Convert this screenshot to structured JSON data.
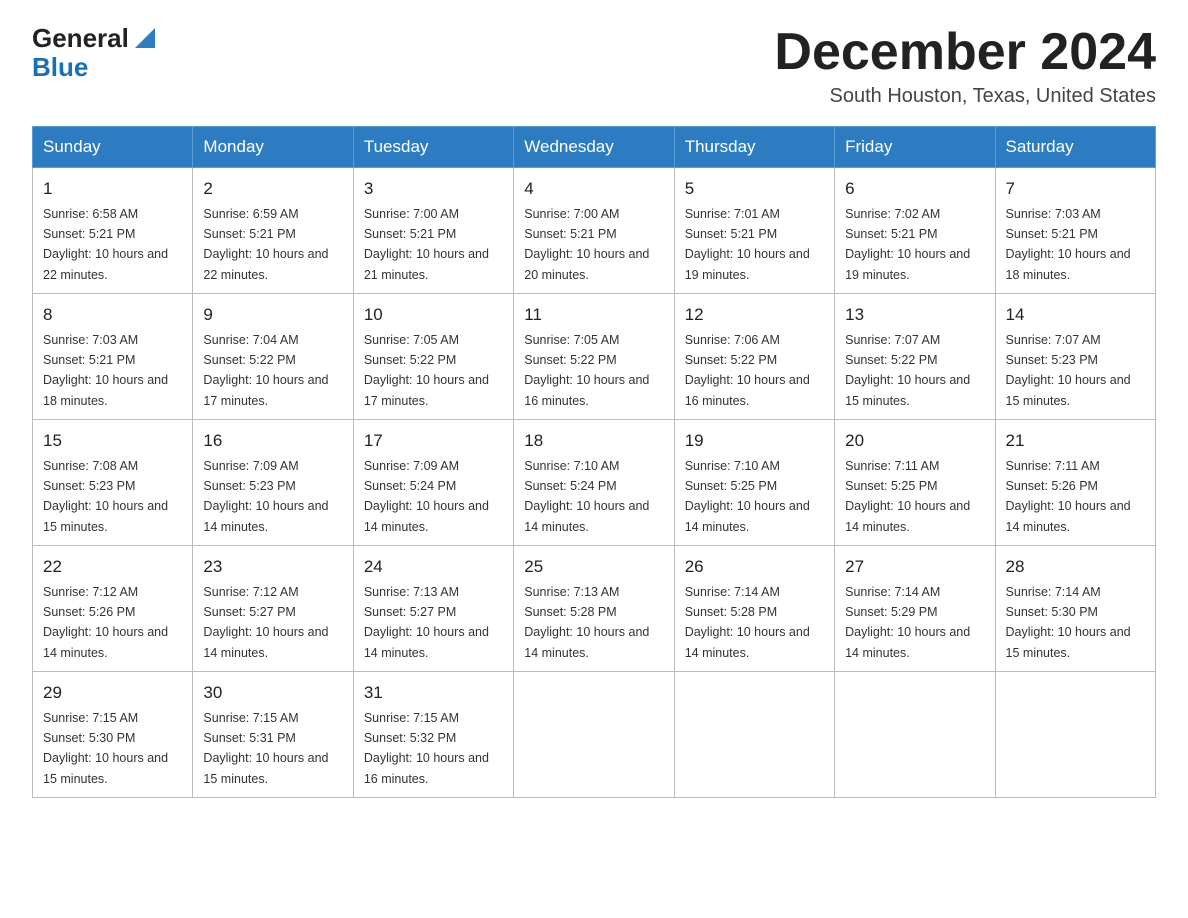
{
  "header": {
    "logo_general": "General",
    "logo_blue": "Blue",
    "month_title": "December 2024",
    "location": "South Houston, Texas, United States"
  },
  "days_of_week": [
    "Sunday",
    "Monday",
    "Tuesday",
    "Wednesday",
    "Thursday",
    "Friday",
    "Saturday"
  ],
  "weeks": [
    [
      {
        "num": "1",
        "sunrise": "6:58 AM",
        "sunset": "5:21 PM",
        "daylight": "10 hours and 22 minutes."
      },
      {
        "num": "2",
        "sunrise": "6:59 AM",
        "sunset": "5:21 PM",
        "daylight": "10 hours and 22 minutes."
      },
      {
        "num": "3",
        "sunrise": "7:00 AM",
        "sunset": "5:21 PM",
        "daylight": "10 hours and 21 minutes."
      },
      {
        "num": "4",
        "sunrise": "7:00 AM",
        "sunset": "5:21 PM",
        "daylight": "10 hours and 20 minutes."
      },
      {
        "num": "5",
        "sunrise": "7:01 AM",
        "sunset": "5:21 PM",
        "daylight": "10 hours and 19 minutes."
      },
      {
        "num": "6",
        "sunrise": "7:02 AM",
        "sunset": "5:21 PM",
        "daylight": "10 hours and 19 minutes."
      },
      {
        "num": "7",
        "sunrise": "7:03 AM",
        "sunset": "5:21 PM",
        "daylight": "10 hours and 18 minutes."
      }
    ],
    [
      {
        "num": "8",
        "sunrise": "7:03 AM",
        "sunset": "5:21 PM",
        "daylight": "10 hours and 18 minutes."
      },
      {
        "num": "9",
        "sunrise": "7:04 AM",
        "sunset": "5:22 PM",
        "daylight": "10 hours and 17 minutes."
      },
      {
        "num": "10",
        "sunrise": "7:05 AM",
        "sunset": "5:22 PM",
        "daylight": "10 hours and 17 minutes."
      },
      {
        "num": "11",
        "sunrise": "7:05 AM",
        "sunset": "5:22 PM",
        "daylight": "10 hours and 16 minutes."
      },
      {
        "num": "12",
        "sunrise": "7:06 AM",
        "sunset": "5:22 PM",
        "daylight": "10 hours and 16 minutes."
      },
      {
        "num": "13",
        "sunrise": "7:07 AM",
        "sunset": "5:22 PM",
        "daylight": "10 hours and 15 minutes."
      },
      {
        "num": "14",
        "sunrise": "7:07 AM",
        "sunset": "5:23 PM",
        "daylight": "10 hours and 15 minutes."
      }
    ],
    [
      {
        "num": "15",
        "sunrise": "7:08 AM",
        "sunset": "5:23 PM",
        "daylight": "10 hours and 15 minutes."
      },
      {
        "num": "16",
        "sunrise": "7:09 AM",
        "sunset": "5:23 PM",
        "daylight": "10 hours and 14 minutes."
      },
      {
        "num": "17",
        "sunrise": "7:09 AM",
        "sunset": "5:24 PM",
        "daylight": "10 hours and 14 minutes."
      },
      {
        "num": "18",
        "sunrise": "7:10 AM",
        "sunset": "5:24 PM",
        "daylight": "10 hours and 14 minutes."
      },
      {
        "num": "19",
        "sunrise": "7:10 AM",
        "sunset": "5:25 PM",
        "daylight": "10 hours and 14 minutes."
      },
      {
        "num": "20",
        "sunrise": "7:11 AM",
        "sunset": "5:25 PM",
        "daylight": "10 hours and 14 minutes."
      },
      {
        "num": "21",
        "sunrise": "7:11 AM",
        "sunset": "5:26 PM",
        "daylight": "10 hours and 14 minutes."
      }
    ],
    [
      {
        "num": "22",
        "sunrise": "7:12 AM",
        "sunset": "5:26 PM",
        "daylight": "10 hours and 14 minutes."
      },
      {
        "num": "23",
        "sunrise": "7:12 AM",
        "sunset": "5:27 PM",
        "daylight": "10 hours and 14 minutes."
      },
      {
        "num": "24",
        "sunrise": "7:13 AM",
        "sunset": "5:27 PM",
        "daylight": "10 hours and 14 minutes."
      },
      {
        "num": "25",
        "sunrise": "7:13 AM",
        "sunset": "5:28 PM",
        "daylight": "10 hours and 14 minutes."
      },
      {
        "num": "26",
        "sunrise": "7:14 AM",
        "sunset": "5:28 PM",
        "daylight": "10 hours and 14 minutes."
      },
      {
        "num": "27",
        "sunrise": "7:14 AM",
        "sunset": "5:29 PM",
        "daylight": "10 hours and 14 minutes."
      },
      {
        "num": "28",
        "sunrise": "7:14 AM",
        "sunset": "5:30 PM",
        "daylight": "10 hours and 15 minutes."
      }
    ],
    [
      {
        "num": "29",
        "sunrise": "7:15 AM",
        "sunset": "5:30 PM",
        "daylight": "10 hours and 15 minutes."
      },
      {
        "num": "30",
        "sunrise": "7:15 AM",
        "sunset": "5:31 PM",
        "daylight": "10 hours and 15 minutes."
      },
      {
        "num": "31",
        "sunrise": "7:15 AM",
        "sunset": "5:32 PM",
        "daylight": "10 hours and 16 minutes."
      },
      null,
      null,
      null,
      null
    ]
  ],
  "labels": {
    "sunrise": "Sunrise:",
    "sunset": "Sunset:",
    "daylight": "Daylight:"
  }
}
